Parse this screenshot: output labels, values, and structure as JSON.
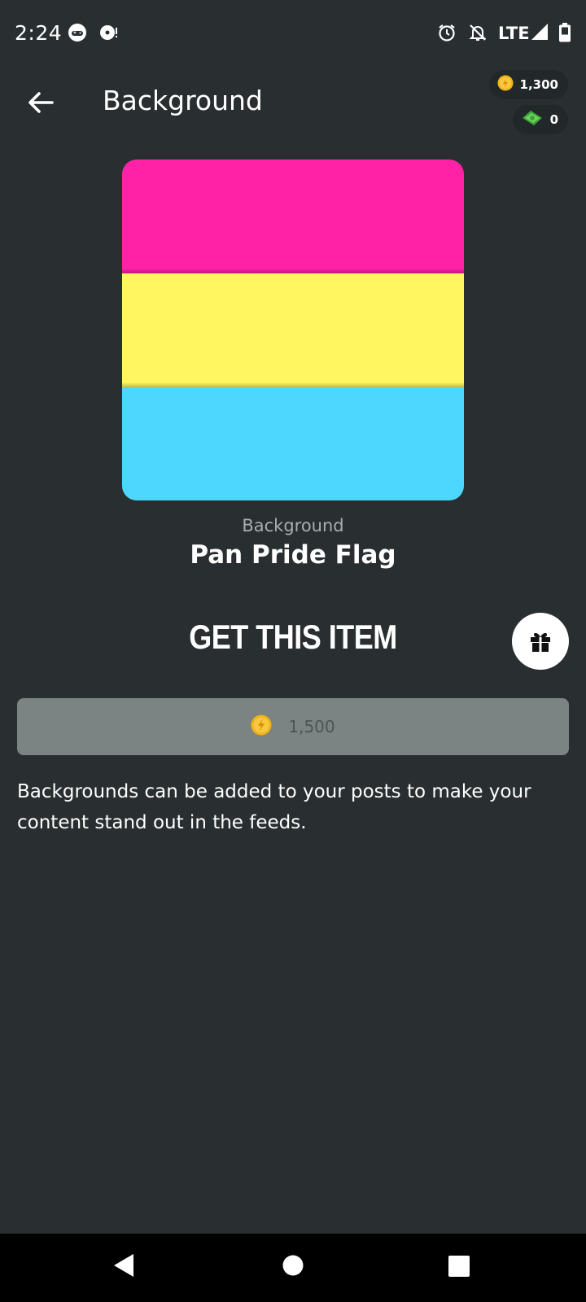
{
  "status_bar": {
    "time": "2:24",
    "network": "LTE",
    "icons": [
      "gamepad-icon",
      "media-icon",
      "alarm-icon",
      "notifications-off-icon",
      "signal-icon",
      "battery-icon"
    ]
  },
  "header": {
    "title": "Background",
    "coins_balance": "1,300",
    "cash_balance": "0"
  },
  "item": {
    "type_label": "Background",
    "name": "Pan Pride Flag",
    "stripes": [
      "#ff21a6",
      "#fff660",
      "#4dd6fe"
    ]
  },
  "purchase": {
    "heading": "GET THIS ITEM",
    "price": "1,500"
  },
  "description": "Backgrounds can be added to your posts to make your content stand out in the feeds.",
  "colors": {
    "background": "#292f30",
    "coin": "#f2b418",
    "cash": "#5fc948",
    "buy_button": "#7c8383"
  }
}
